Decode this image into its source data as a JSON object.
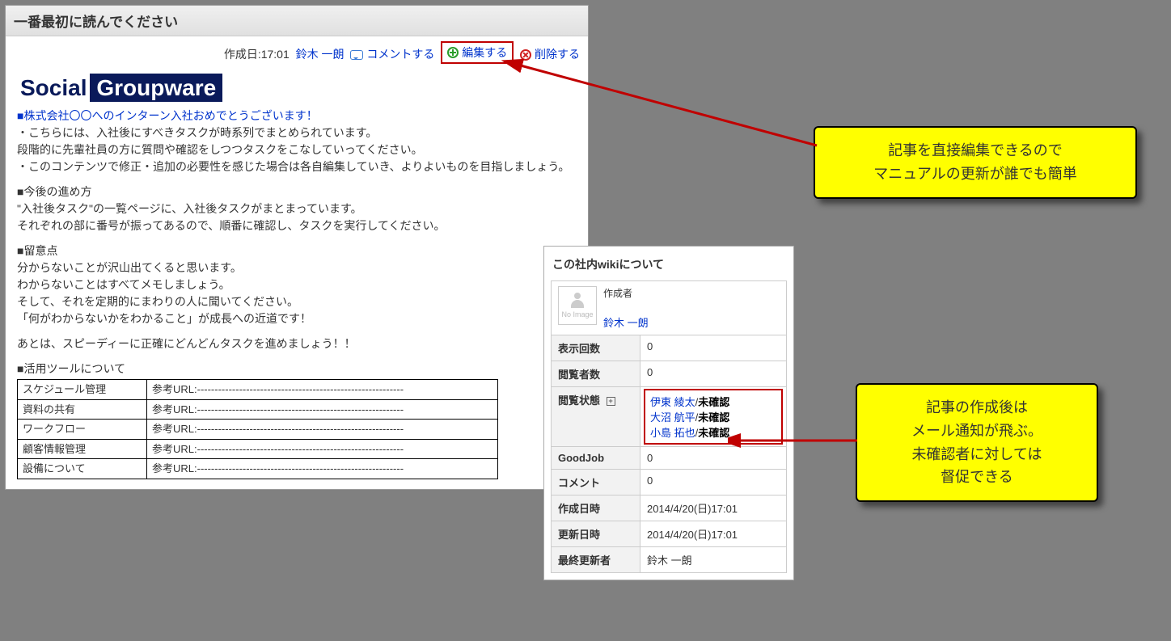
{
  "article": {
    "title": "一番最初に読んでください",
    "created_label": "作成日:17:01",
    "author": "鈴木 一朗",
    "actions": {
      "comment": "コメントする",
      "edit": "編集する",
      "delete": "削除する"
    },
    "logo": {
      "part1": "Social",
      "part2": "Groupware"
    },
    "body": {
      "link1": "■株式会社〇〇へのインターン入社おめでとうございます！",
      "p1a": "・こちらには、入社後にすべきタスクが時系列でまとめられています。",
      "p1b": "段階的に先輩社員の方に質問や確認をしつつタスクをこなしていってください。",
      "p1c": "・このコンテンツで修正・追加の必要性を感じた場合は各自編集していき、よりよいものを目指しましょう。",
      "h2": "■今後の進め方",
      "p2a": "\"入社後タスク\"の一覧ページに、入社後タスクがまとまっています。",
      "p2b": "それぞれの部に番号が振ってあるので、順番に確認し、タスクを実行してください。",
      "h3": "■留意点",
      "p3a": "分からないことが沢山出てくると思います。",
      "p3b": "わからないことはすべてメモしましょう。",
      "p3c": "そして、それを定期的にまわりの人に聞いてください。",
      "p3d": "「何がわからないかをわかること」が成長への近道です！",
      "p4": "あとは、スピーディーに正確にどんどんタスクを進めましょう！！",
      "h5": "■活用ツールについて"
    },
    "tools": [
      {
        "name": "スケジュール管理",
        "url": "参考URL:-----------------------------------------------------------"
      },
      {
        "name": "資料の共有",
        "url": "参考URL:-----------------------------------------------------------"
      },
      {
        "name": "ワークフロー",
        "url": "参考URL:-----------------------------------------------------------"
      },
      {
        "name": "顧客情報管理",
        "url": "参考URL:-----------------------------------------------------------"
      },
      {
        "name": "設備について",
        "url": "参考URL:-----------------------------------------------------------"
      }
    ]
  },
  "wiki": {
    "title": "この社内wikiについて",
    "author_label": "作成者",
    "no_image": "No Image",
    "author_name": "鈴木 一朗",
    "rows": {
      "views_label": "表示回数",
      "views": "0",
      "readers_label": "閲覧者数",
      "readers": "0",
      "status_label": "閲覧状態",
      "goodjob_label": "GoodJob",
      "goodjob": "0",
      "comment_label": "コメント",
      "comment": "0",
      "created_label": "作成日時",
      "created": "2014/4/20(日)17:01",
      "updated_label": "更新日時",
      "updated": "2014/4/20(日)17:01",
      "updater_label": "最終更新者",
      "updater": "鈴木 一朗"
    },
    "reading": [
      {
        "name": "伊東 綾太",
        "status": "未確認"
      },
      {
        "name": "大沼 航平",
        "status": "未確認"
      },
      {
        "name": "小島 拓也",
        "status": "未確認"
      }
    ]
  },
  "callouts": {
    "c1a": "記事を直接編集できるので",
    "c1b": "マニュアルの更新が誰でも簡単",
    "c2a": "記事の作成後は",
    "c2b": "メール通知が飛ぶ。",
    "c2c": "未確認者に対しては",
    "c2d": "督促できる"
  }
}
